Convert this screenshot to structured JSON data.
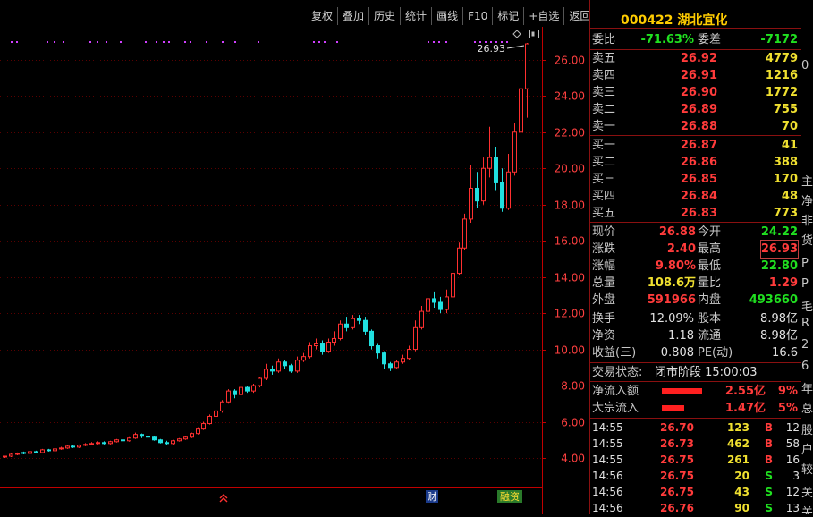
{
  "toolbar": [
    "复权",
    "叠加",
    "历史",
    "统计",
    "画线",
    "F10",
    "标记",
    "+自选",
    "返回"
  ],
  "stock": {
    "code": "000422",
    "name": "湖北宜化"
  },
  "commission": {
    "ratio_label": "委比",
    "ratio": "-71.63%",
    "diff_label": "委差",
    "diff": "-7172"
  },
  "asks": [
    {
      "label": "卖五",
      "price": "26.92",
      "vol": "4779"
    },
    {
      "label": "卖四",
      "price": "26.91",
      "vol": "1216"
    },
    {
      "label": "卖三",
      "price": "26.90",
      "vol": "1772"
    },
    {
      "label": "卖二",
      "price": "26.89",
      "vol": "755"
    },
    {
      "label": "卖一",
      "price": "26.88",
      "vol": "70"
    }
  ],
  "bids": [
    {
      "label": "买一",
      "price": "26.87",
      "vol": "41"
    },
    {
      "label": "买二",
      "price": "26.86",
      "vol": "388"
    },
    {
      "label": "买三",
      "price": "26.85",
      "vol": "170"
    },
    {
      "label": "买四",
      "price": "26.84",
      "vol": "48"
    },
    {
      "label": "买五",
      "price": "26.83",
      "vol": "773"
    }
  ],
  "quote": [
    {
      "l1": "现价",
      "v1": "26.88",
      "c1": "red",
      "l2": "今开",
      "v2": "24.22",
      "c2": "green"
    },
    {
      "l1": "涨跌",
      "v1": "2.40",
      "c1": "red",
      "l2": "最高",
      "v2": "26.93",
      "c2": "red"
    },
    {
      "l1": "涨幅",
      "v1": "9.80%",
      "c1": "red",
      "l2": "最低",
      "v2": "22.80",
      "c2": "green"
    },
    {
      "l1": "总量",
      "v1": "108.6万",
      "c1": "yellow",
      "l2": "量比",
      "v2": "1.29",
      "c2": "red"
    },
    {
      "l1": "外盘",
      "v1": "591966",
      "c1": "red",
      "l2": "内盘",
      "v2": "493660",
      "c2": "green"
    }
  ],
  "fundamentals": [
    {
      "l1": "换手",
      "v1": "12.09%",
      "l2": "股本",
      "v2": "8.98亿"
    },
    {
      "l1": "净资",
      "v1": "1.18",
      "l2": "流通",
      "v2": "8.98亿"
    },
    {
      "l1": "收益(三)",
      "v1": "0.808",
      "l2": "PE(动)",
      "v2": "16.6"
    }
  ],
  "trade_status": {
    "label": "交易状态:",
    "value": "闭市阶段 15:00:03"
  },
  "flows": [
    {
      "label": "净流入额",
      "amount": "2.55亿",
      "pct": "9%",
      "bar_fraction": 0.9
    },
    {
      "label": "大宗流入",
      "amount": "1.47亿",
      "pct": "5%",
      "bar_fraction": 0.5
    }
  ],
  "ticks": [
    {
      "time": "14:55",
      "price": "26.70",
      "vol": "123",
      "side": "B",
      "n": "12"
    },
    {
      "time": "14:55",
      "price": "26.73",
      "vol": "462",
      "side": "B",
      "n": "58"
    },
    {
      "time": "14:55",
      "price": "26.75",
      "vol": "261",
      "side": "B",
      "n": "16"
    },
    {
      "time": "14:56",
      "price": "26.75",
      "vol": "20",
      "side": "S",
      "n": "3"
    },
    {
      "time": "14:56",
      "price": "26.75",
      "vol": "43",
      "side": "S",
      "n": "12"
    },
    {
      "time": "14:56",
      "price": "26.76",
      "vol": "90",
      "side": "S",
      "n": "13"
    }
  ],
  "edge_chars": [
    "0",
    "主",
    "净",
    "非",
    "货",
    "P",
    "P",
    "毛",
    "R",
    "2",
    "6",
    "年",
    "总",
    "股",
    "户",
    "较",
    "关",
    "关"
  ],
  "chart_data": {
    "type": "candlestick",
    "ylim": [
      3.0,
      27.2
    ],
    "y_ticks": [
      "26.00",
      "24.00",
      "22.00",
      "20.00",
      "18.00",
      "16.00",
      "14.00",
      "12.00",
      "10.00",
      "8.00",
      "6.00",
      "4.00"
    ],
    "high_label": "26.93",
    "markers": [
      "财",
      "融资"
    ],
    "colors": {
      "up": "#ff3030",
      "down": "#20e0e0",
      "grid": "#5a0000",
      "axis": "#c00000"
    },
    "candles": [
      [
        4.05,
        4.1,
        4.0,
        4.12
      ],
      [
        4.1,
        4.2,
        4.05,
        4.25
      ],
      [
        4.2,
        4.25,
        4.15,
        4.3
      ],
      [
        4.3,
        4.25,
        4.2,
        4.35
      ],
      [
        4.25,
        4.35,
        4.2,
        4.4
      ],
      [
        4.35,
        4.3,
        4.25,
        4.4
      ],
      [
        4.3,
        4.45,
        4.25,
        4.5
      ],
      [
        4.45,
        4.4,
        4.35,
        4.5
      ],
      [
        4.4,
        4.5,
        4.35,
        4.55
      ],
      [
        4.5,
        4.55,
        4.45,
        4.62
      ],
      [
        4.55,
        4.65,
        4.5,
        4.7
      ],
      [
        4.65,
        4.6,
        4.55,
        4.7
      ],
      [
        4.6,
        4.7,
        4.55,
        4.75
      ],
      [
        4.7,
        4.75,
        4.65,
        4.82
      ],
      [
        4.75,
        4.8,
        4.7,
        4.88
      ],
      [
        4.8,
        4.85,
        4.75,
        4.92
      ],
      [
        4.85,
        4.8,
        4.75,
        4.92
      ],
      [
        4.8,
        4.9,
        4.75,
        4.95
      ],
      [
        4.9,
        5.0,
        4.85,
        5.05
      ],
      [
        5.0,
        4.95,
        4.9,
        5.05
      ],
      [
        4.95,
        5.1,
        4.9,
        5.15
      ],
      [
        5.1,
        5.3,
        5.05,
        5.4
      ],
      [
        5.3,
        5.2,
        5.1,
        5.35
      ],
      [
        5.2,
        5.15,
        5.05,
        5.25
      ],
      [
        5.15,
        5.0,
        4.95,
        5.2
      ],
      [
        5.0,
        4.85,
        4.8,
        5.05
      ],
      [
        4.85,
        4.8,
        4.7,
        4.95
      ],
      [
        4.8,
        4.95,
        4.75,
        5.0
      ],
      [
        4.95,
        5.05,
        4.9,
        5.1
      ],
      [
        5.05,
        5.15,
        5.0,
        5.2
      ],
      [
        5.15,
        5.35,
        5.1,
        5.4
      ],
      [
        5.35,
        5.6,
        5.3,
        5.7
      ],
      [
        5.6,
        5.9,
        5.55,
        6.0
      ],
      [
        5.9,
        6.3,
        5.85,
        6.4
      ],
      [
        6.3,
        6.6,
        6.2,
        6.7
      ],
      [
        6.6,
        7.1,
        6.5,
        7.2
      ],
      [
        7.1,
        7.7,
        7.0,
        7.8
      ],
      [
        7.7,
        7.5,
        7.3,
        7.8
      ],
      [
        7.5,
        7.9,
        7.4,
        8.0
      ],
      [
        7.9,
        7.7,
        7.6,
        8.0
      ],
      [
        7.7,
        8.0,
        7.6,
        8.1
      ],
      [
        8.0,
        8.4,
        7.9,
        8.5
      ],
      [
        8.4,
        8.9,
        8.3,
        9.2
      ],
      [
        8.9,
        8.8,
        8.6,
        9.1
      ],
      [
        8.8,
        9.3,
        8.7,
        9.5
      ],
      [
        9.3,
        9.1,
        8.9,
        9.4
      ],
      [
        9.1,
        8.8,
        8.7,
        9.2
      ],
      [
        8.8,
        9.4,
        8.7,
        9.6
      ],
      [
        9.4,
        9.6,
        9.3,
        9.8
      ],
      [
        9.6,
        10.2,
        9.5,
        10.4
      ],
      [
        10.2,
        10.3,
        10.0,
        10.6
      ],
      [
        10.3,
        9.9,
        9.7,
        10.5
      ],
      [
        9.9,
        10.4,
        9.8,
        10.6
      ],
      [
        10.4,
        10.6,
        10.2,
        11.0
      ],
      [
        10.6,
        11.4,
        10.5,
        11.6
      ],
      [
        11.4,
        11.2,
        11.0,
        11.8
      ],
      [
        11.2,
        11.7,
        11.1,
        11.9
      ],
      [
        11.7,
        11.6,
        11.4,
        11.9
      ],
      [
        11.6,
        11.0,
        10.8,
        11.8
      ],
      [
        11.0,
        10.2,
        10.0,
        11.1
      ],
      [
        10.2,
        9.8,
        9.5,
        10.3
      ],
      [
        9.8,
        9.2,
        8.9,
        9.9
      ],
      [
        9.2,
        9.0,
        8.8,
        9.3
      ],
      [
        9.0,
        9.3,
        8.9,
        9.4
      ],
      [
        9.3,
        9.5,
        9.2,
        9.7
      ],
      [
        9.5,
        10.0,
        9.4,
        10.2
      ],
      [
        10.0,
        11.2,
        9.9,
        11.6
      ],
      [
        11.2,
        12.1,
        11.1,
        12.4
      ],
      [
        12.1,
        12.8,
        12.0,
        13.0
      ],
      [
        12.8,
        12.6,
        12.3,
        13.2
      ],
      [
        12.6,
        12.2,
        12.0,
        12.9
      ],
      [
        12.2,
        12.9,
        12.0,
        13.3
      ],
      [
        12.9,
        14.2,
        12.8,
        14.5
      ],
      [
        14.2,
        15.6,
        14.1,
        15.9
      ],
      [
        15.6,
        17.2,
        15.5,
        17.5
      ],
      [
        17.2,
        18.9,
        17.0,
        20.2
      ],
      [
        18.9,
        18.2,
        17.8,
        19.8
      ],
      [
        18.2,
        20.0,
        18.0,
        20.6
      ],
      [
        20.0,
        20.6,
        19.5,
        22.3
      ],
      [
        20.6,
        19.2,
        18.8,
        21.2
      ],
      [
        19.2,
        17.8,
        17.6,
        20.0
      ],
      [
        17.8,
        19.8,
        17.7,
        20.8
      ],
      [
        19.8,
        22.0,
        19.6,
        22.5
      ],
      [
        22.0,
        24.4,
        21.8,
        24.6
      ],
      [
        24.4,
        26.88,
        22.8,
        26.93
      ]
    ]
  }
}
